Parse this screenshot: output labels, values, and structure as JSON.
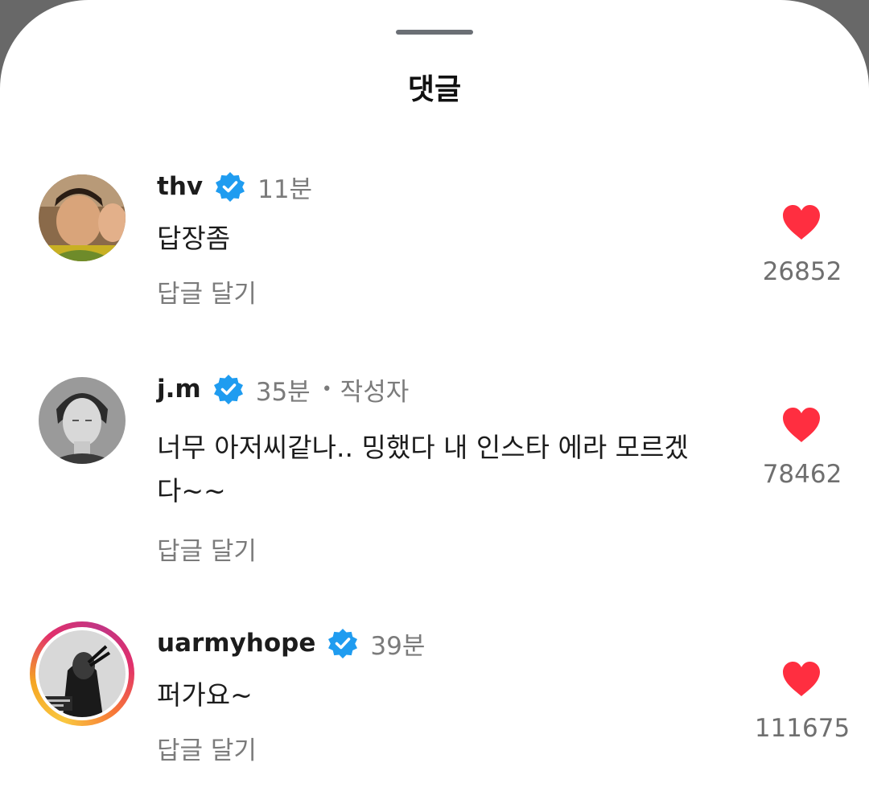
{
  "sheet": {
    "title": "댓글"
  },
  "comments": [
    {
      "username": "thv",
      "time": "11분",
      "author_label": "",
      "text": "답장좀",
      "reply_label": "답글 달기",
      "likes": "26852"
    },
    {
      "username": "j.m",
      "time": "35분",
      "author_label": "작성자",
      "text": "너무 아저씨같나.. 밍했다 내 인스타 에라 모르겠다~~",
      "reply_label": "답글 달기",
      "likes": "78462"
    },
    {
      "username": "uarmyhope",
      "time": "39분",
      "author_label": "",
      "text": "퍼가요~",
      "reply_label": "답글 달기",
      "likes": "111675"
    }
  ],
  "colors": {
    "heart": "#ff2e40",
    "verified": "#1f9cf0",
    "muted_text": "#7b7b7b"
  },
  "icons": {
    "verified": "verified-badge-icon",
    "like": "heart-icon"
  }
}
